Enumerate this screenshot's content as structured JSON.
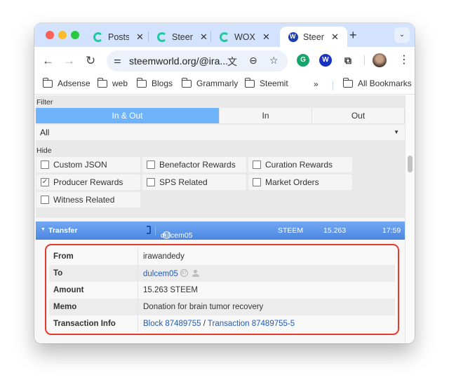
{
  "browser": {
    "tabs": [
      {
        "title": "Posts",
        "favicon": "steemit-icon",
        "active": false
      },
      {
        "title": "Steem",
        "favicon": "steemit-icon",
        "active": false
      },
      {
        "title": "WOX-",
        "favicon": "steemit-icon",
        "active": false
      },
      {
        "title": "Steem",
        "favicon": "steemworld-icon",
        "active": true
      }
    ],
    "new_tab_label": "+",
    "url": "steemworld.org/@ira...",
    "bookmarks": [
      "Adsense",
      "web",
      "Blogs",
      "Grammarly",
      "Steemit"
    ],
    "bookmarks_overflow": "»",
    "all_bookmarks_label": "All Bookmarks"
  },
  "filter": {
    "label": "Filter",
    "segments": [
      {
        "label": "In & Out",
        "active": true
      },
      {
        "label": "In",
        "active": false
      },
      {
        "label": "Out",
        "active": false
      }
    ],
    "type_select": "All"
  },
  "hide": {
    "label": "Hide",
    "options": [
      {
        "label": "Custom JSON",
        "checked": false
      },
      {
        "label": "Benefactor Rewards",
        "checked": false
      },
      {
        "label": "Curation Rewards",
        "checked": false
      },
      {
        "label": "Producer Rewards",
        "checked": true
      },
      {
        "label": "SPS Related",
        "checked": false
      },
      {
        "label": "Market Orders",
        "checked": false
      },
      {
        "label": "Witness Related",
        "checked": false
      }
    ]
  },
  "transfer": {
    "title": "Transfer",
    "counterparty": "dulcem05",
    "reputation": "67",
    "currency": "STEEM",
    "amount": "15.263",
    "time": "17:59",
    "details": {
      "from_label": "From",
      "from": "irawandedy",
      "to_label": "To",
      "to": "dulcem05",
      "to_reputation": "67",
      "amount_label": "Amount",
      "amount": "15.263 STEEM",
      "memo_label": "Memo",
      "memo": "Donation for brain tumor recovery",
      "tx_label": "Transaction Info",
      "block": "Block 87489755",
      "separator": "/",
      "transaction": "Transaction 87489755-5"
    }
  },
  "colors": {
    "accent_segment": "#6fb3fb",
    "transfer_bar": "#5b92e8",
    "highlight_border": "#e53a2a",
    "link": "#1f5bb8"
  }
}
